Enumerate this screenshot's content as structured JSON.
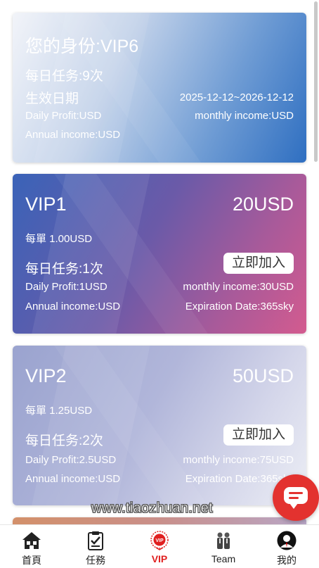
{
  "status_card": {
    "title": "您的身份:VIP6",
    "daily_tasks": "每日任务:9次",
    "effective_date_label": "生效日期",
    "effective_date_value": "2025-12-12~2026-12-12",
    "daily_profit": "Daily Profit:USD",
    "monthly_income": "monthly income:USD",
    "annual_income": "Annual income:USD"
  },
  "plans": [
    {
      "name": "VIP1",
      "price": "20USD",
      "per_order": "每單 1.00USD",
      "daily_tasks": "每日任务:1次",
      "join_label": "立即加入",
      "daily_profit": "Daily Profit:1USD",
      "monthly_income": "monthly income:30USD",
      "annual_income": "Annual income:USD",
      "expiration": "Expiration Date:365sky"
    },
    {
      "name": "VIP2",
      "price": "50USD",
      "per_order": "每單 1.25USD",
      "daily_tasks": "每日任务:2次",
      "join_label": "立即加入",
      "daily_profit": "Daily Profit:2.5USD",
      "monthly_income": "monthly income:75USD",
      "annual_income": "Annual income:USD",
      "expiration": "Expiration Date:365sky"
    }
  ],
  "watermark": "www.tiaozhuan.net",
  "chat_button": {
    "icon": "chat-bubble-icon"
  },
  "tabbar": {
    "items": [
      {
        "label": "首頁",
        "icon": "home-icon"
      },
      {
        "label": "任務",
        "icon": "clipboard-icon"
      },
      {
        "label": "VIP",
        "icon": "vip-badge-icon",
        "active": true
      },
      {
        "label": "Team",
        "icon": "team-icon"
      },
      {
        "label": "我的",
        "icon": "avatar-icon"
      }
    ]
  },
  "colors": {
    "accent": "#e02020",
    "chat": "#e3322f"
  }
}
